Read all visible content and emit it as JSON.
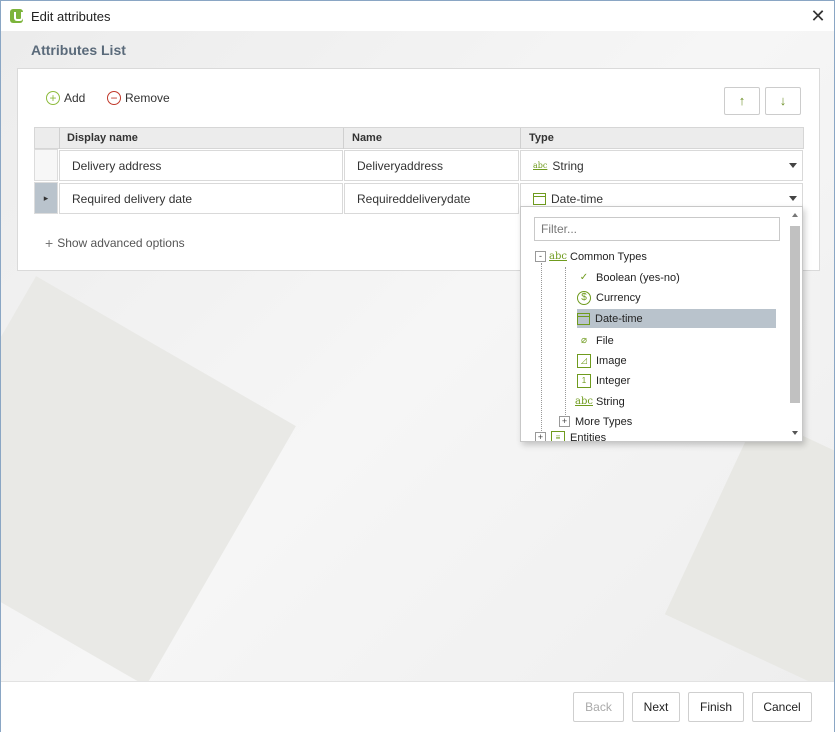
{
  "window": {
    "title": "Edit attributes"
  },
  "page": {
    "title": "Attributes List"
  },
  "toolbar": {
    "add_label": "Add",
    "remove_label": "Remove",
    "up_label": "↑",
    "down_label": "↓"
  },
  "grid": {
    "columns": [
      "Display name",
      "Name",
      "Type"
    ],
    "rows": [
      {
        "indicator": "",
        "display_name": "Delivery address",
        "name": "Deliveryaddress",
        "type": "String",
        "type_icon": "abc-icon"
      },
      {
        "indicator": "▸",
        "display_name": "Required delivery date",
        "name": "Requireddeliverydate",
        "type": "Date-time",
        "type_icon": "calendar-icon"
      }
    ]
  },
  "advanced_options": {
    "label": "Show advanced options"
  },
  "type_dropdown": {
    "filter_placeholder": "Filter...",
    "groups": [
      {
        "label": "Common Types",
        "expander": "-",
        "icon": "abc-icon"
      },
      {
        "label": "More Types",
        "expander": "+"
      },
      {
        "label": "Entities",
        "expander": "+",
        "icon": "entity-icon"
      }
    ],
    "items": [
      {
        "label": "Boolean (yes-no)",
        "icon": "checkmark-icon"
      },
      {
        "label": "Currency",
        "icon": "dollar-icon"
      },
      {
        "label": "Date-time",
        "icon": "calendar-icon",
        "selected": true
      },
      {
        "label": "File",
        "icon": "paperclip-icon"
      },
      {
        "label": "Image",
        "icon": "image-icon"
      },
      {
        "label": "Integer",
        "icon": "integer-icon"
      },
      {
        "label": "String",
        "icon": "abc-icon"
      }
    ]
  },
  "icons": {
    "abc": "abc",
    "integer": "1",
    "dollar": "$"
  },
  "footer": {
    "back_label": "Back",
    "next_label": "Next",
    "finish_label": "Finish",
    "cancel_label": "Cancel"
  },
  "colors": {
    "accent_green": "#6f9b1e",
    "selection": "#b9c3cc",
    "remove_red": "#c0392b"
  }
}
